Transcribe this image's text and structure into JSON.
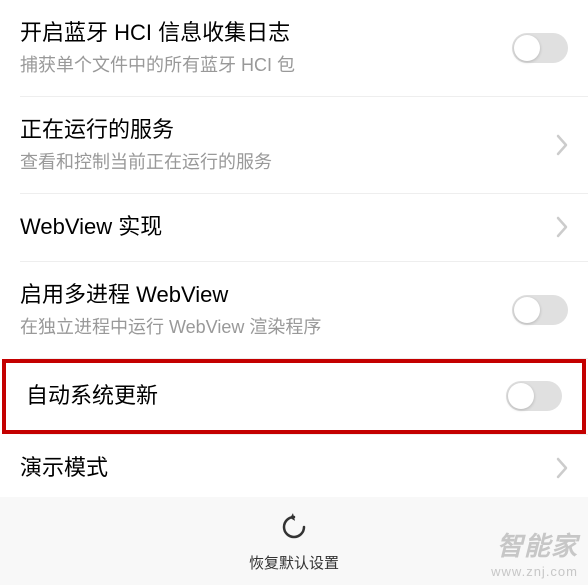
{
  "settings": {
    "bluetooth_hci": {
      "title": "开启蓝牙 HCI 信息收集日志",
      "subtitle": "捕获单个文件中的所有蓝牙 HCI 包"
    },
    "running_services": {
      "title": "正在运行的服务",
      "subtitle": "查看和控制当前正在运行的服务"
    },
    "webview_impl": {
      "title": "WebView 实现"
    },
    "multi_process_webview": {
      "title": "启用多进程 WebView",
      "subtitle": "在独立进程中运行 WebView 渲染程序"
    },
    "auto_system_update": {
      "title": "自动系统更新"
    },
    "demo_mode": {
      "title": "演示模式"
    }
  },
  "footer": {
    "reset_label": "恢复默认设置"
  },
  "watermark": {
    "text": "智能家",
    "url": "www.znj.com"
  }
}
